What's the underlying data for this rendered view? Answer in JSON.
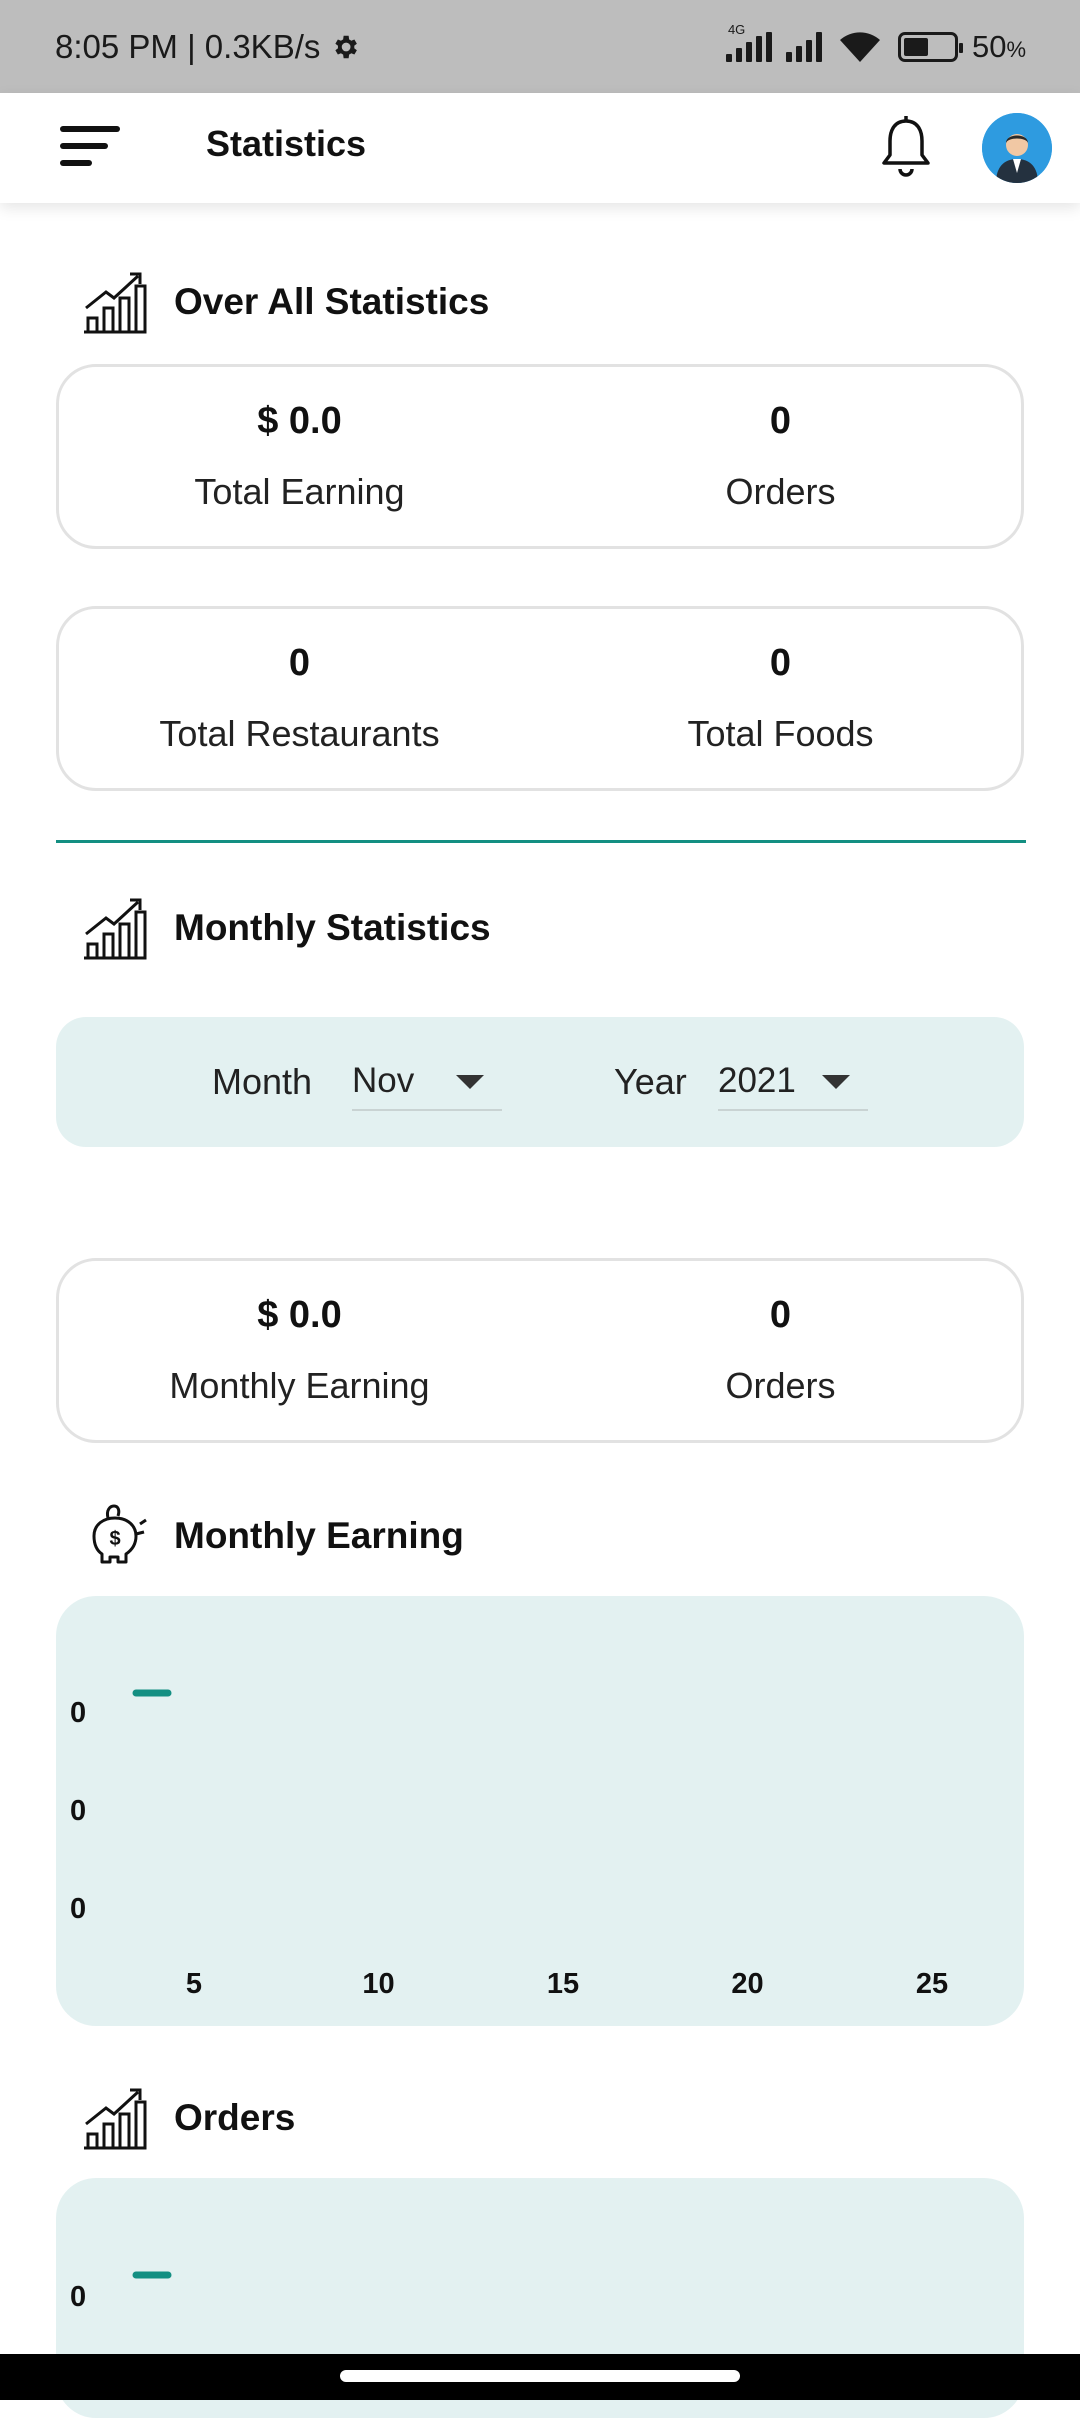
{
  "status_bar": {
    "time_speed": "8:05 PM | 0.3KB/s",
    "network_tag": "4G",
    "battery_percent": "50",
    "battery_unit": "%",
    "battery_level": 0.5
  },
  "app_bar": {
    "title": "Statistics",
    "menu_icon": "hamburger-menu-icon",
    "notification_icon": "bell-icon",
    "avatar_icon": "user-avatar"
  },
  "overall": {
    "title": "Over All Statistics",
    "icon": "growth-chart-icon",
    "card1": {
      "left_value": "$ 0.0",
      "left_label": "Total Earning",
      "right_value": "0",
      "right_label": "Orders"
    },
    "card2": {
      "left_value": "0",
      "left_label": "Total Restaurants",
      "right_value": "0",
      "right_label": "Total Foods"
    }
  },
  "monthly": {
    "title": "Monthly Statistics",
    "icon": "growth-chart-icon",
    "month_label": "Month",
    "month_value": "Nov",
    "year_label": "Year",
    "year_value": "2021",
    "card": {
      "left_value": "$ 0.0",
      "left_label": "Monthly Earning",
      "right_value": "0",
      "right_label": "Orders"
    }
  },
  "earning_chart_section": {
    "title": "Monthly Earning",
    "icon": "piggy-bank-icon"
  },
  "orders_chart_section": {
    "title": "Orders",
    "icon": "growth-chart-icon"
  },
  "colors": {
    "accent": "#138f82",
    "panel": "#e3f1f1"
  },
  "chart_data": [
    {
      "type": "line",
      "x_ticks": [
        "5",
        "10",
        "15",
        "20",
        "25"
      ],
      "y_ticks": [
        "0",
        "0",
        "0"
      ],
      "series": [
        {
          "x": [
            1
          ],
          "y": [
            0
          ]
        }
      ]
    },
    {
      "type": "line",
      "x_ticks": [],
      "y_ticks": [
        "0"
      ],
      "series": [
        {
          "x": [
            1
          ],
          "y": [
            0
          ]
        }
      ]
    }
  ]
}
